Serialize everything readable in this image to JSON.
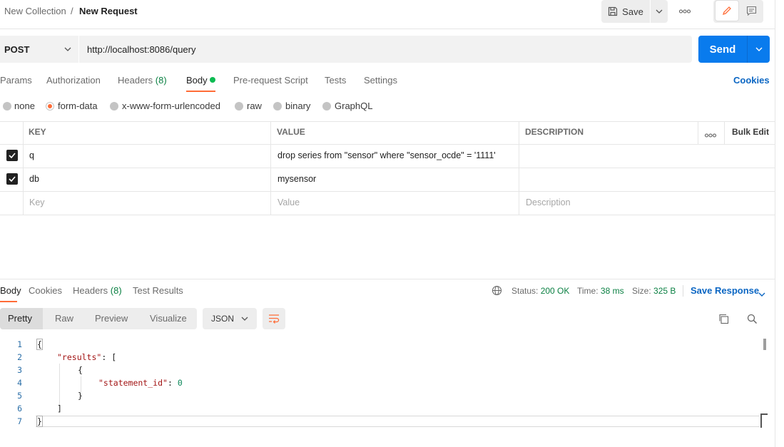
{
  "breadcrumb": {
    "collection": "New Collection",
    "separator": "/",
    "request": "New Request"
  },
  "header": {
    "save_label": "Save"
  },
  "request": {
    "method": "POST",
    "url": "http://localhost:8086/query",
    "send_label": "Send"
  },
  "request_tabs": {
    "params": "Params",
    "authorization": "Authorization",
    "headers": "Headers",
    "headers_count": "(8)",
    "body": "Body",
    "prerequest": "Pre-request Script",
    "tests": "Tests",
    "settings": "Settings",
    "cookies": "Cookies"
  },
  "body_types": {
    "none": "none",
    "form_data": "form-data",
    "urlencoded": "x-www-form-urlencoded",
    "raw": "raw",
    "binary": "binary",
    "graphql": "GraphQL",
    "selected": "form-data"
  },
  "table": {
    "headers": {
      "key": "KEY",
      "value": "VALUE",
      "description": "DESCRIPTION",
      "bulk_edit": "Bulk Edit"
    },
    "rows": [
      {
        "key": "q",
        "value": "drop series from \"sensor\" where \"sensor_ocde\" = '1111'",
        "checked": true
      },
      {
        "key": "db",
        "value": "mysensor",
        "checked": true
      }
    ],
    "placeholders": {
      "key": "Key",
      "value": "Value",
      "description": "Description"
    }
  },
  "response_tabs": {
    "body": "Body",
    "cookies": "Cookies",
    "headers": "Headers",
    "headers_count": "(8)",
    "test_results": "Test Results"
  },
  "response_meta": {
    "status_label": "Status:",
    "status_value": "200 OK",
    "time_label": "Time:",
    "time_value": "38 ms",
    "size_label": "Size:",
    "size_value": "325 B",
    "save_response": "Save Response"
  },
  "view": {
    "pretty": "Pretty",
    "raw": "Raw",
    "preview": "Preview",
    "visualize": "Visualize",
    "format": "JSON"
  },
  "code": {
    "line_numbers": [
      "1",
      "2",
      "3",
      "4",
      "5",
      "6",
      "7"
    ],
    "brace_open": "{",
    "results_key": "\"results\"",
    "colon": ":",
    "bracket_open": "[",
    "obj_open": "{",
    "statement_key": "\"statement_id\"",
    "statement_value": "0",
    "obj_close": "}",
    "bracket_close": "]",
    "brace_close": "}"
  },
  "colors": {
    "accent": "#ff6c37",
    "send": "#097bed",
    "link": "#0b66c3",
    "success": "#0b8043"
  }
}
